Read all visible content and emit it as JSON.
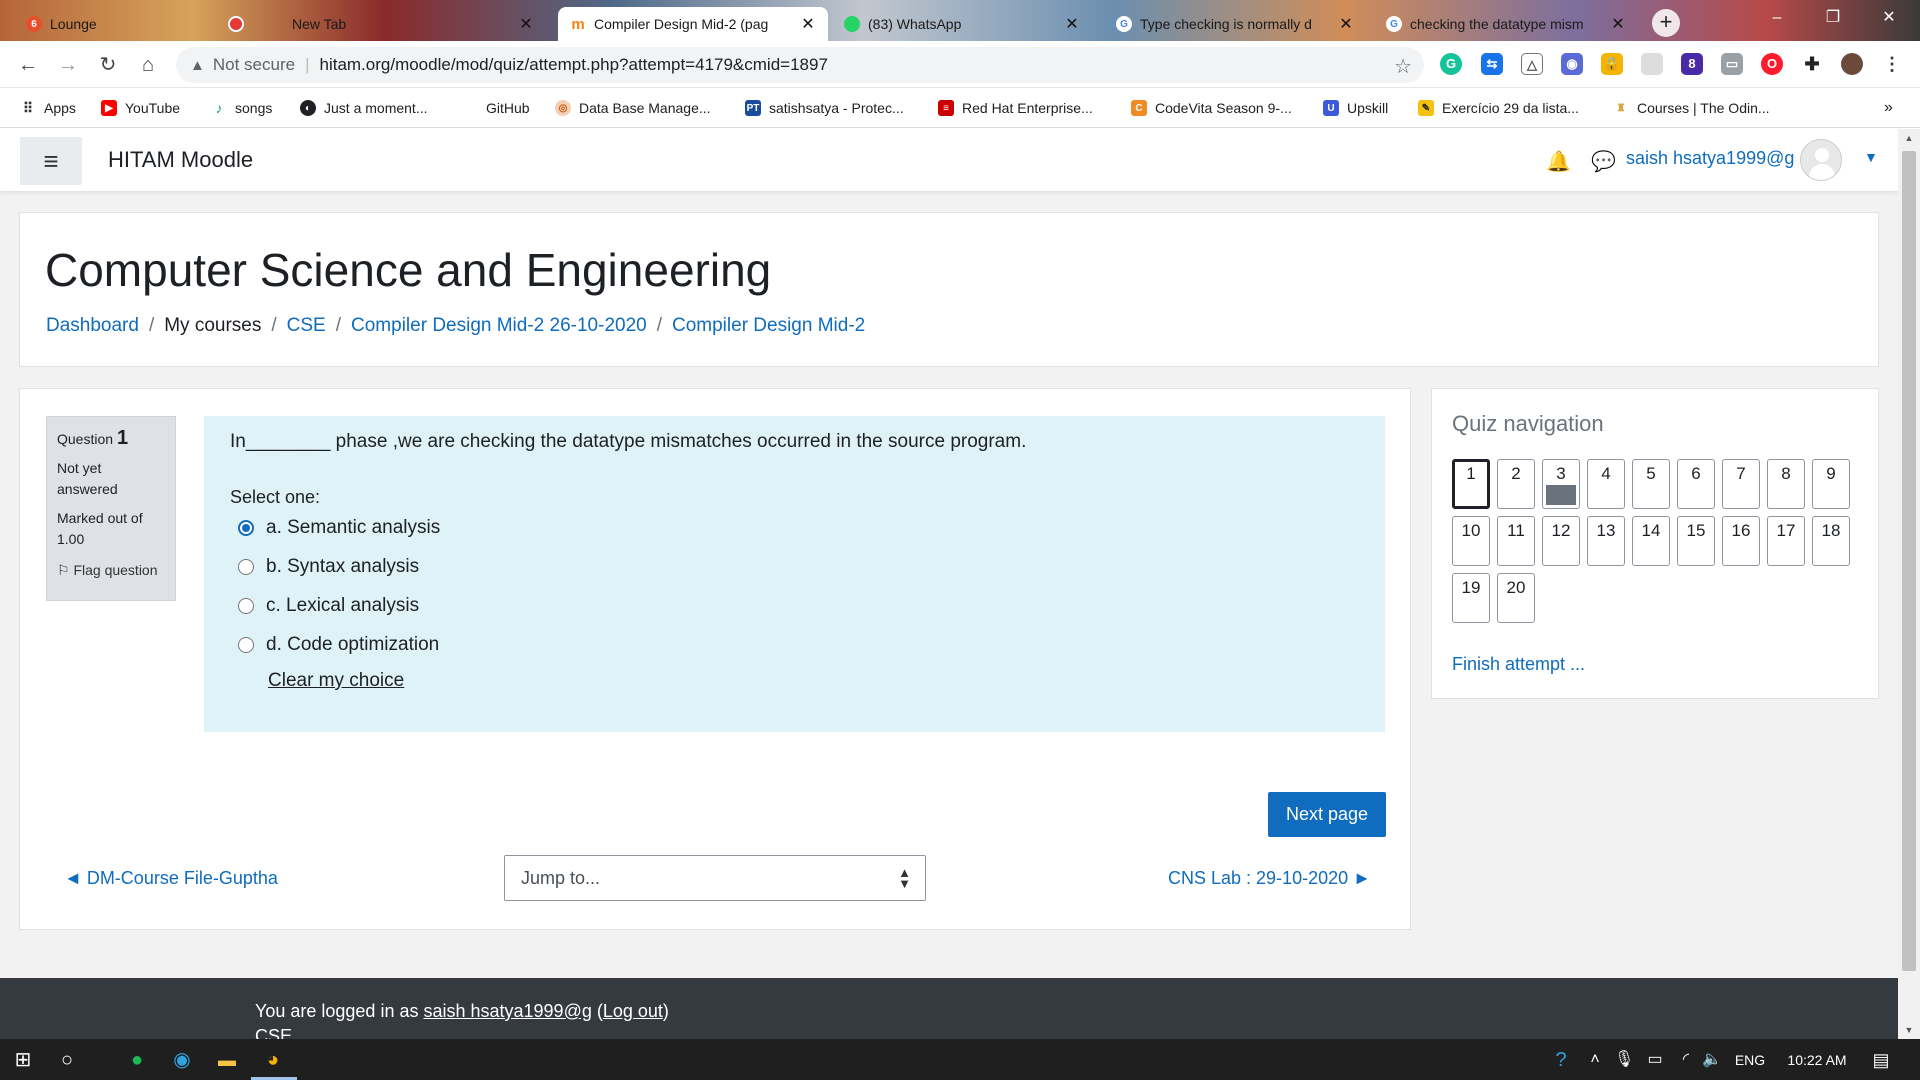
{
  "browser": {
    "tabs": [
      {
        "title": "Lounge",
        "favicon": "lounge-icon",
        "color": "#e94e2b",
        "badge": "6"
      },
      {
        "title": "New Tab",
        "favicon": "record-icon",
        "color": "#e53935"
      },
      {
        "title": "Compiler Design Mid-2 (pag",
        "favicon": "moodle-icon",
        "color": "#f98012",
        "active": true
      },
      {
        "title": "(83) WhatsApp",
        "favicon": "whatsapp-icon",
        "color": "#25d366",
        "badge": "83"
      },
      {
        "title": "Type checking is normally d",
        "favicon": "google-icon",
        "color": "#4285f4"
      },
      {
        "title": "checking the datatype mism",
        "favicon": "google-icon",
        "color": "#4285f4"
      }
    ],
    "address": {
      "security": "Not secure",
      "url": "hitam.org/moodle/mod/quiz/attempt.php?attempt=4179&cmid=1897"
    },
    "extension_badge": "8",
    "bookmarks": [
      {
        "label": "Apps",
        "icon": "apps-grid-icon",
        "color": "#5f6368"
      },
      {
        "label": "YouTube",
        "icon": "youtube-icon",
        "color": "#ff0000"
      },
      {
        "label": "songs",
        "icon": "songs-icon",
        "color": "#1aa260"
      },
      {
        "label": "Just a moment...",
        "icon": "globe-icon",
        "color": "#202124"
      },
      {
        "label": "GitHub",
        "icon": "github-icon",
        "color": "#ffffff"
      },
      {
        "label": "Data Base Manage...",
        "icon": "db-icon",
        "color": "#c45a1a"
      },
      {
        "label": "satishsatya - Protec...",
        "icon": "pt-icon",
        "color": "#1a4e9c"
      },
      {
        "label": "Red Hat Enterprise...",
        "icon": "redhat-icon",
        "color": "#cc0000"
      },
      {
        "label": "CodeVita Season 9-...",
        "icon": "codevita-icon",
        "color": "#f08a24"
      },
      {
        "label": "Upskill",
        "icon": "upskill-icon",
        "color": "#3b5bdb"
      },
      {
        "label": "Exercício 29 da lista...",
        "icon": "pencil-icon",
        "color": "#f4c20d"
      },
      {
        "label": "Courses | The Odin...",
        "icon": "odin-icon",
        "color": "#d9a441"
      }
    ],
    "more_bookmarks": "»"
  },
  "moodle": {
    "site_name": "HITAM Moodle",
    "user_name": "saish hsatya1999@g",
    "course_title": "Computer Science and Engineering",
    "breadcrumb": {
      "dashboard": "Dashboard",
      "my_courses": "My courses",
      "cse": "CSE",
      "mid2_date": "Compiler Design Mid-2 26-10-2020",
      "mid2": "Compiler Design Mid-2"
    },
    "question_info": {
      "label": "Question",
      "number": "1",
      "status": "Not yet answered",
      "marked": "Marked out of 1.00",
      "flag": "Flag question"
    },
    "question": {
      "text": "In________ phase ,we are checking the datatype mismatches occurred in the source program.",
      "select_label": "Select one:",
      "options": [
        {
          "label": "a. Semantic analysis",
          "selected": true
        },
        {
          "label": "b. Syntax analysis",
          "selected": false
        },
        {
          "label": "c. Lexical analysis",
          "selected": false
        },
        {
          "label": "d. Code optimization",
          "selected": false
        }
      ],
      "clear": "Clear my choice"
    },
    "next_page": "Next page",
    "prev_activity": "◄ DM-Course File-Guptha",
    "jump_to": "Jump to...",
    "next_activity": "CNS Lab : 29-10-2020 ►",
    "quiz_nav": {
      "title": "Quiz navigation",
      "current": 1,
      "answered": [
        3
      ],
      "buttons": [
        "1",
        "2",
        "3",
        "4",
        "5",
        "6",
        "7",
        "8",
        "9",
        "10",
        "11",
        "12",
        "13",
        "14",
        "15",
        "16",
        "17",
        "18",
        "19",
        "20"
      ],
      "finish": "Finish attempt ..."
    },
    "footer": {
      "prefix": "You are logged in as ",
      "user": "saish hsatya1999@g",
      "open_paren": " (",
      "logout": "Log out",
      "close_paren": ")",
      "cse": "CSE"
    },
    "primary_color": "#0f6cbf"
  },
  "taskbar": {
    "language": "ENG",
    "time": "10:22 AM"
  }
}
